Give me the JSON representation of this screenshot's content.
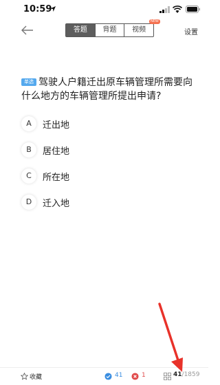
{
  "status": {
    "time": "10:59"
  },
  "header": {
    "tabs": [
      {
        "label": "答题",
        "active": true
      },
      {
        "label": "背题",
        "active": false
      },
      {
        "label": "视频",
        "active": false
      }
    ],
    "new_badge": "NEW",
    "settings_label": "设置"
  },
  "question": {
    "type": "单选",
    "text": "驾驶人户籍迁出原车辆管理所需要向什么地方的车辆管理所提出申请?",
    "options": [
      {
        "letter": "A",
        "text": "迁出地"
      },
      {
        "letter": "B",
        "text": "居住地"
      },
      {
        "letter": "C",
        "text": "所在地"
      },
      {
        "letter": "D",
        "text": "迁入地"
      }
    ]
  },
  "footer": {
    "favorite_label": "收藏",
    "correct_count": "41",
    "wrong_count": "1",
    "progress_current": "41",
    "progress_total": "/1859"
  },
  "colors": {
    "accent": "#55a9ee",
    "correct": "#3a8de0",
    "wrong": "#e04a4a",
    "annotation_arrow": "#e8322a"
  }
}
